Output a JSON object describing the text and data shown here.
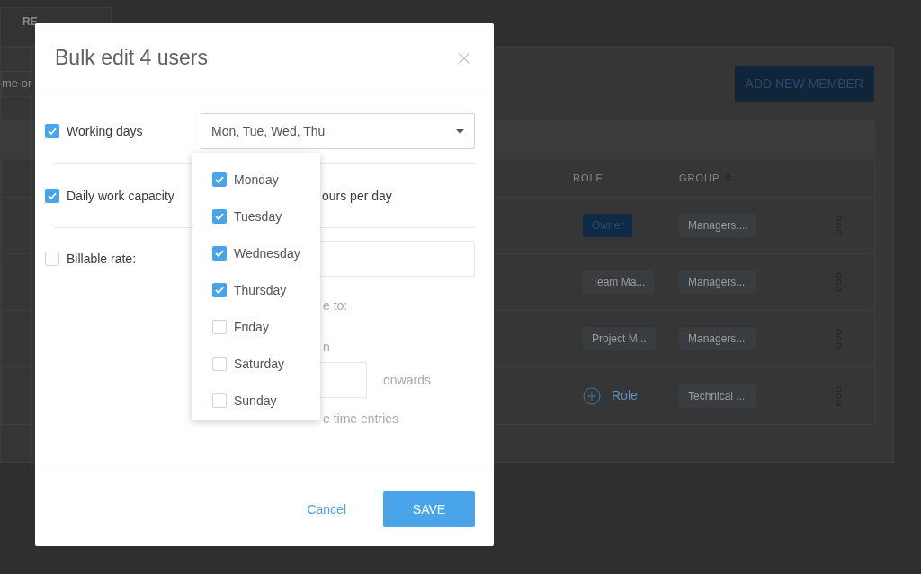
{
  "background": {
    "tab": "RE",
    "search": {
      "placeholder": "me or"
    },
    "add_button": "ADD NEW MEMBER",
    "table": {
      "columns": [
        "ROLE",
        "GROUP"
      ],
      "rows": [
        {
          "role": {
            "kind": "owner",
            "text": "Owner"
          },
          "group": "Managers,..."
        },
        {
          "role": {
            "kind": "tag",
            "text": "Team Ma..."
          },
          "group": "Managers..."
        },
        {
          "role": {
            "kind": "tag",
            "text": "Project M..."
          },
          "group": "Managers..."
        },
        {
          "role": {
            "kind": "add",
            "text": "Role"
          },
          "group": "Technical ..."
        }
      ]
    }
  },
  "dialog": {
    "title": "Bulk edit 4 users",
    "working_days": {
      "label": "Working days",
      "checked": true,
      "value": "Mon, Tue, Wed, Thu",
      "options": [
        {
          "label": "Monday",
          "checked": true
        },
        {
          "label": "Tuesday",
          "checked": true
        },
        {
          "label": "Wednesday",
          "checked": true
        },
        {
          "label": "Thursday",
          "checked": true
        },
        {
          "label": "Friday",
          "checked": false
        },
        {
          "label": "Saturday",
          "checked": false
        },
        {
          "label": "Sunday",
          "checked": false
        }
      ]
    },
    "capacity": {
      "label": "Daily work capacity",
      "checked": true,
      "suffix": "ours per day"
    },
    "billable": {
      "label": "Billable rate:",
      "checked": false,
      "apply_text": "e to:",
      "option_text": "n",
      "onwards": "onwards",
      "entries_text": "e time entries"
    },
    "buttons": {
      "cancel": "Cancel",
      "save": "SAVE"
    }
  }
}
